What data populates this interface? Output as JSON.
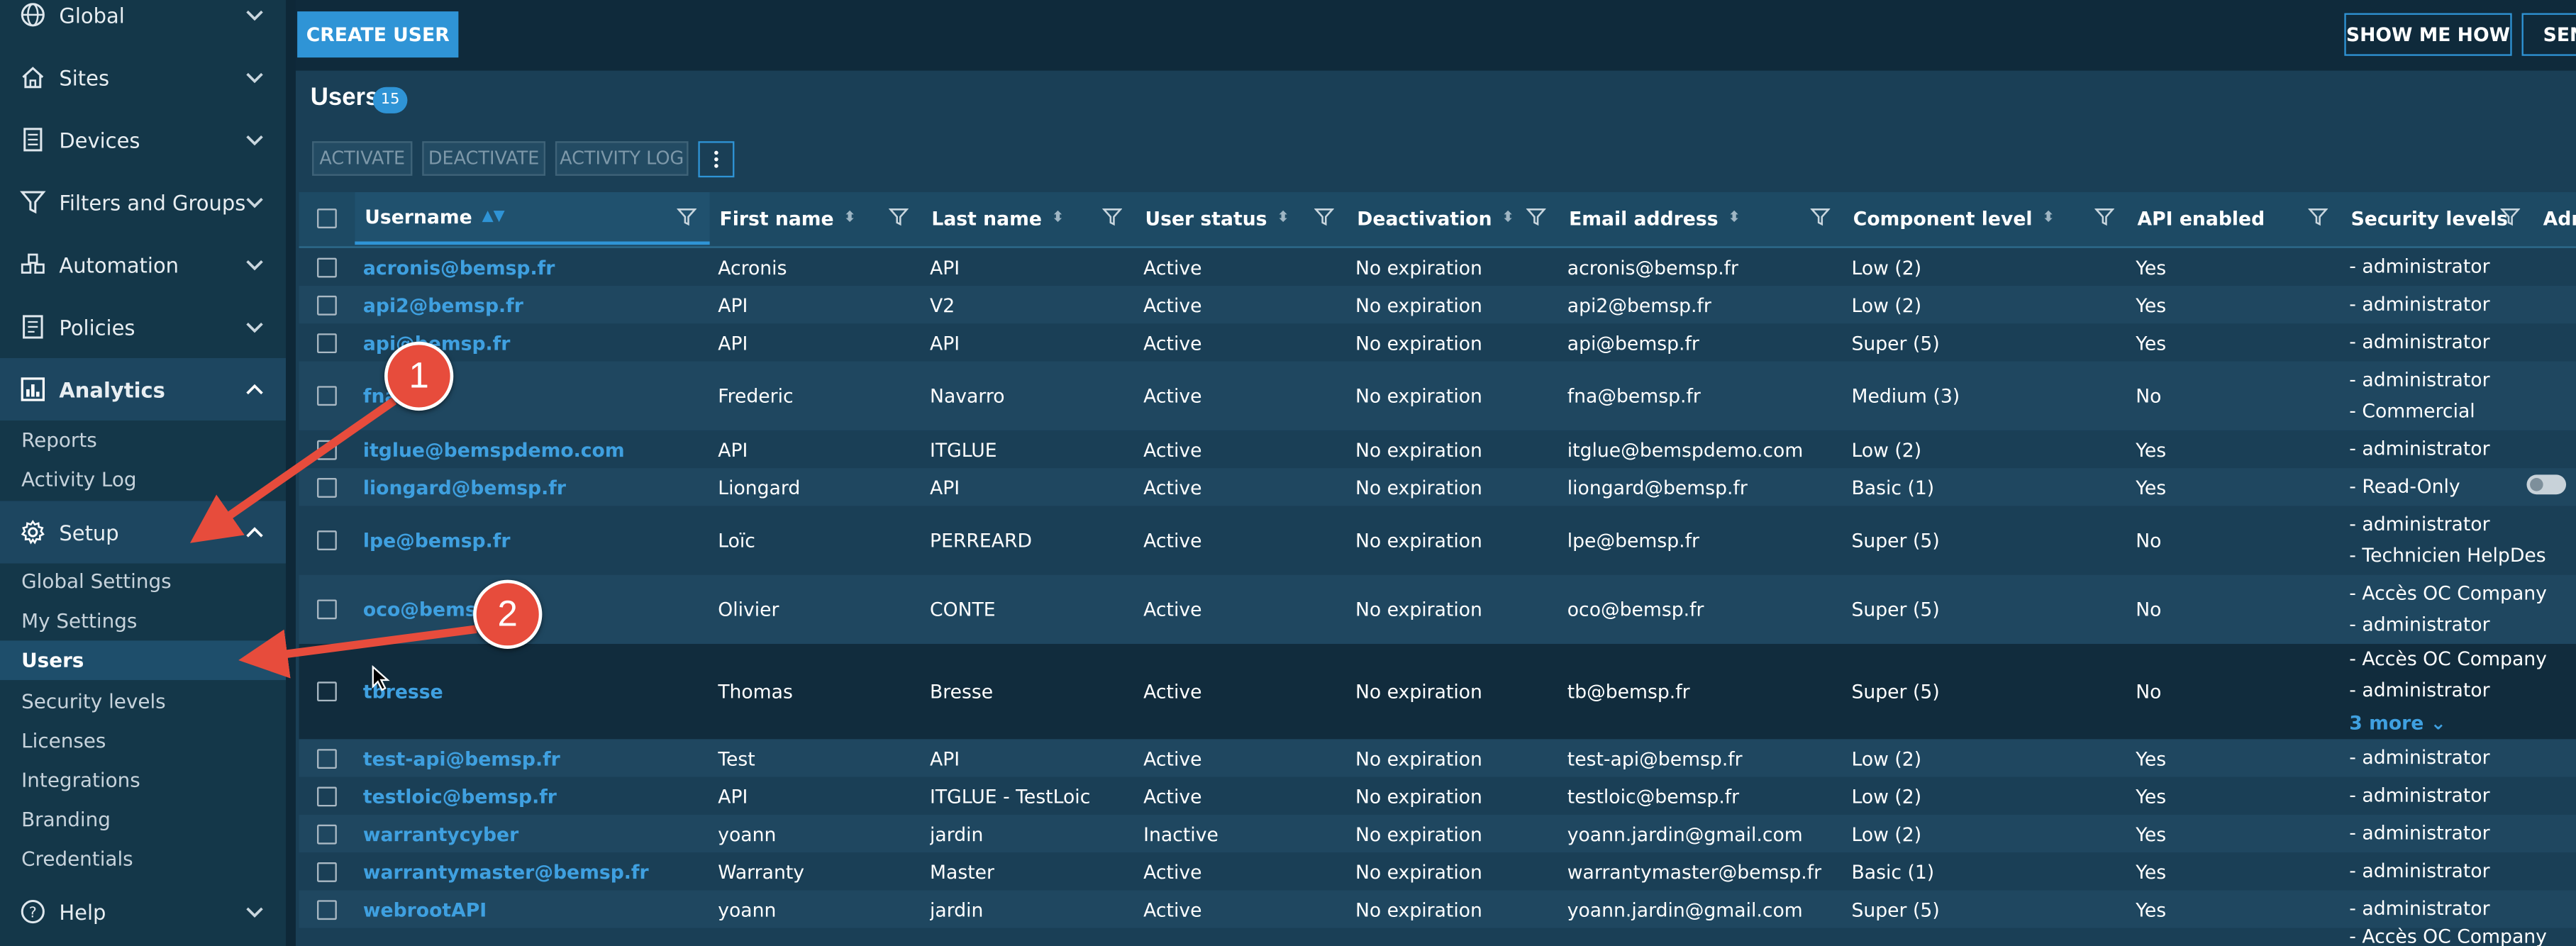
{
  "sidebar": {
    "nav": [
      {
        "label": "Global",
        "icon": "globe-icon"
      },
      {
        "label": "Sites",
        "icon": "home-icon"
      },
      {
        "label": "Devices",
        "icon": "server-icon"
      },
      {
        "label": "Filters and Groups",
        "icon": "filter-icon"
      },
      {
        "label": "Automation",
        "icon": "automation-icon"
      },
      {
        "label": "Policies",
        "icon": "policy-icon"
      },
      {
        "label": "Analytics",
        "icon": "chart-icon"
      }
    ],
    "analytics_sub": [
      "Reports",
      "Activity Log"
    ],
    "setup": {
      "label": "Setup",
      "icon": "gear-icon"
    },
    "setup_sub": [
      "Global Settings",
      "My Settings",
      "Users",
      "Security levels",
      "Licenses",
      "Integrations",
      "Branding",
      "Credentials"
    ],
    "help": {
      "label": "Help",
      "icon": "help-icon"
    }
  },
  "toolbar": {
    "create_user": "CREATE USER",
    "show_me_how": "SHOW ME HOW",
    "send_partial": "SEN"
  },
  "page": {
    "title": "Users",
    "count": "15"
  },
  "actions": {
    "activate": "ACTIVATE",
    "deactivate": "DEACTIVATE",
    "activity_log": "ACTIVITY LOG"
  },
  "table": {
    "columns": [
      "Username",
      "First name",
      "Last name",
      "User status",
      "Deactivation",
      "Email address",
      "Component level",
      "API enabled",
      "Security levels",
      "Adm"
    ],
    "rows": [
      {
        "username": "acronis@bemsp.fr",
        "first": "Acronis",
        "last": "API",
        "status": "Active",
        "deact": "No expiration",
        "email": "acronis@bemsp.fr",
        "level": "Low (2)",
        "api": "Yes",
        "security": [
          "- administrator"
        ]
      },
      {
        "username": "api2@bemsp.fr",
        "first": "API",
        "last": "V2",
        "status": "Active",
        "deact": "No expiration",
        "email": "api2@bemsp.fr",
        "level": "Low (2)",
        "api": "Yes",
        "security": [
          "- administrator"
        ]
      },
      {
        "username": "api@bemsp.fr",
        "first": "API",
        "last": "API",
        "status": "Active",
        "deact": "No expiration",
        "email": "api@bemsp.fr",
        "level": "Super (5)",
        "api": "Yes",
        "security": [
          "- administrator"
        ]
      },
      {
        "username": "fna",
        "first": "Frederic",
        "last": "Navarro",
        "status": "Active",
        "deact": "No expiration",
        "email": "fna@bemsp.fr",
        "level": "Medium (3)",
        "api": "No",
        "security": [
          "- administrator",
          "- Commercial"
        ]
      },
      {
        "username": "itglue@bemspdemo.com",
        "first": "API",
        "last": "ITGLUE",
        "status": "Active",
        "deact": "No expiration",
        "email": "itglue@bemspdemo.com",
        "level": "Low (2)",
        "api": "Yes",
        "security": [
          "- administrator"
        ]
      },
      {
        "username": "liongard@bemsp.fr",
        "first": "Liongard",
        "last": "API",
        "status": "Active",
        "deact": "No expiration",
        "email": "liongard@bemsp.fr",
        "level": "Basic (1)",
        "api": "Yes",
        "security": [
          "- Read-Only"
        ]
      },
      {
        "username": "lpe@bemsp.fr",
        "first": "Loïc",
        "last": "PERREARD",
        "status": "Active",
        "deact": "No expiration",
        "email": "lpe@bemsp.fr",
        "level": "Super (5)",
        "api": "No",
        "security": [
          "- administrator",
          "- Technicien HelpDes"
        ]
      },
      {
        "username": "oco@bemsp.fr",
        "first": "Olivier",
        "last": "CONTE",
        "status": "Active",
        "deact": "No expiration",
        "email": "oco@bemsp.fr",
        "level": "Super (5)",
        "api": "No",
        "security": [
          "- Accès OC Company",
          "- administrator"
        ]
      },
      {
        "username": "tbresse",
        "first": "Thomas",
        "last": "Bresse",
        "status": "Active",
        "deact": "No expiration",
        "email": "tb@bemsp.fr",
        "level": "Super (5)",
        "api": "No",
        "security": [
          "- Accès OC Company",
          "- administrator"
        ],
        "more": "3 more"
      },
      {
        "username": "test-api@bemsp.fr",
        "first": "Test",
        "last": "API",
        "status": "Active",
        "deact": "No expiration",
        "email": "test-api@bemsp.fr",
        "level": "Low (2)",
        "api": "Yes",
        "security": [
          "- administrator"
        ]
      },
      {
        "username": "testloic@bemsp.fr",
        "first": "API",
        "last": "ITGLUE - TestLoic",
        "status": "Active",
        "deact": "No expiration",
        "email": "testloic@bemsp.fr",
        "level": "Low (2)",
        "api": "Yes",
        "security": [
          "- administrator"
        ]
      },
      {
        "username": "warrantycyber",
        "first": "yoann",
        "last": "jardin",
        "status": "Inactive",
        "deact": "No expiration",
        "email": "yoann.jardin@gmail.com",
        "level": "Low (2)",
        "api": "Yes",
        "security": [
          "- administrator"
        ]
      },
      {
        "username": "warrantymaster@bemsp.fr",
        "first": "Warranty",
        "last": "Master",
        "status": "Active",
        "deact": "No expiration",
        "email": "warrantymaster@bemsp.fr",
        "level": "Basic (1)",
        "api": "Yes",
        "security": [
          "- administrator"
        ]
      },
      {
        "username": "webrootAPI",
        "first": "yoann",
        "last": "jardin",
        "status": "Active",
        "deact": "No expiration",
        "email": "yoann.jardin@gmail.com",
        "level": "Super (5)",
        "api": "Yes",
        "security": [
          "- administrator"
        ]
      },
      {
        "username": "",
        "first": "",
        "last": "",
        "status": "",
        "deact": "",
        "email": "",
        "level": "",
        "api": "",
        "security": [
          "- Accès OC Company"
        ]
      }
    ]
  },
  "annotations": {
    "callout_1": "1",
    "callout_2": "2"
  },
  "colors": {
    "accent": "#2f94d6",
    "callout": "#e74c3c",
    "sidebar": "#143749",
    "content": "#1a3f56"
  }
}
